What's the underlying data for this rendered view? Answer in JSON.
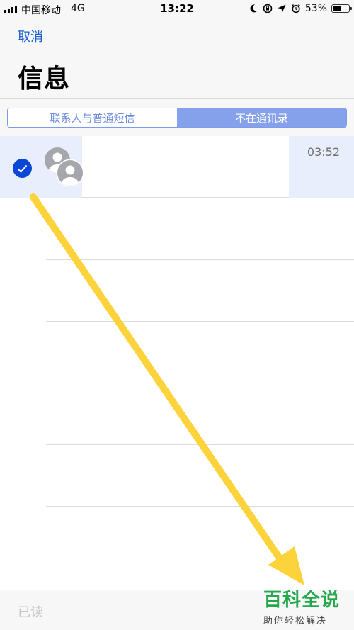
{
  "status": {
    "carrier": "中国移动",
    "network": "4G",
    "time": "13:22",
    "battery": "53%",
    "battery_level": 0.53
  },
  "nav": {
    "cancel_label": "取消",
    "title": "信息"
  },
  "segments": [
    {
      "label": "联系人与普通短信",
      "selected": false
    },
    {
      "label": "不在通讯录",
      "selected": true
    }
  ],
  "messages": [
    {
      "time": "03:52",
      "selected": true
    }
  ],
  "toolbar": {
    "read_label": "已读"
  },
  "watermark": {
    "title": "百科全说",
    "subtitle": "助你轻松解决"
  },
  "colors": {
    "accent": "#1a5fd1",
    "check": "#0b47d6",
    "segment_selected": "#85a1ec",
    "arrow": "#fdd33c",
    "watermark": "#23a94c"
  },
  "icons": [
    "signal-icon",
    "moon-icon",
    "rotation-lock-icon",
    "location-icon",
    "alarm-icon",
    "battery-icon",
    "checkmark-icon",
    "group-avatar-icon"
  ]
}
